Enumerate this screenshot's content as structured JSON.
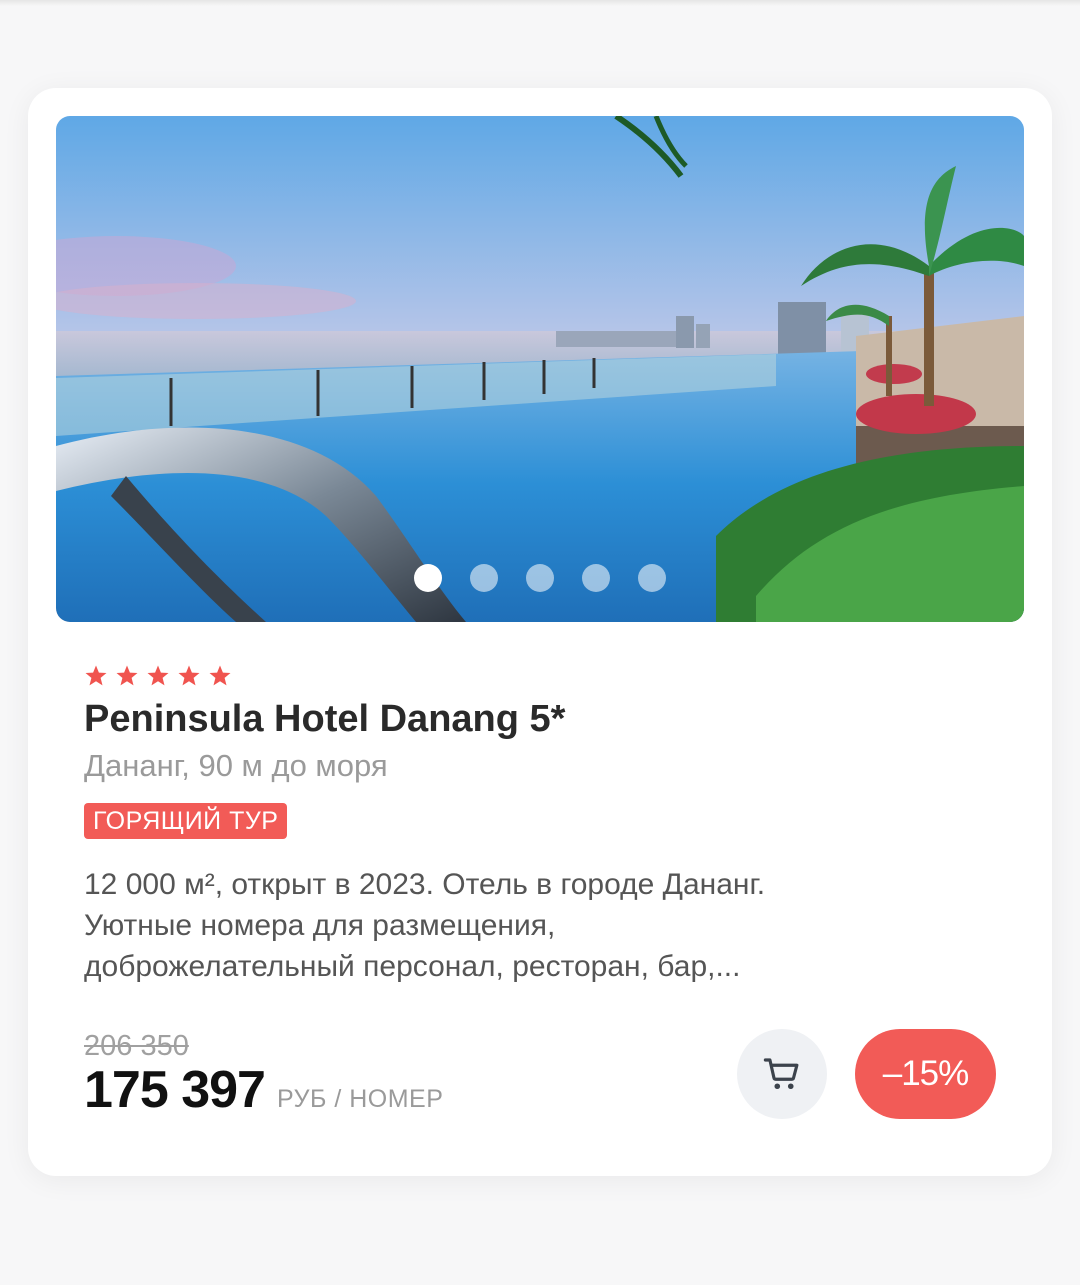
{
  "hotel": {
    "rating_stars": 5,
    "title": "Peninsula Hotel Danang 5*",
    "location": "Дананг, 90 м до моря",
    "badge": "ГОРЯЩИЙ ТУР",
    "description_lines": [
      "12 000 м², открыт в 2023. Отель в городе Дананг.",
      "Уютные номера для размещения,",
      "доброжелательный персонал, ресторан, бар,..."
    ]
  },
  "gallery": {
    "total_slides": 5,
    "active_slide": 1,
    "image_icon": "hotel-pool-photo"
  },
  "pricing": {
    "old_price": "206 350",
    "price": "175 397",
    "unit": "РУБ / НОМЕР",
    "discount": "–15%"
  },
  "icons": {
    "star": "star-icon",
    "cart": "cart-icon"
  },
  "colors": {
    "accent": "#f25b57",
    "star": "#f0544f",
    "cart_bg": "#eff1f4"
  }
}
